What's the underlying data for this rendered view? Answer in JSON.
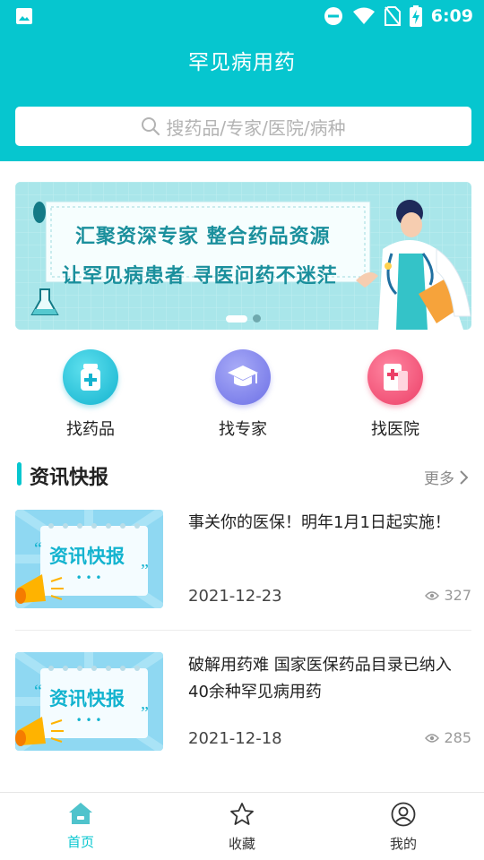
{
  "status_bar": {
    "time": "6:09",
    "icons": [
      "image-icon",
      "dnd-icon",
      "wifi-icon",
      "no-sim-icon",
      "battery-charging-icon"
    ]
  },
  "header": {
    "title": "罕见病用药"
  },
  "search": {
    "placeholder": "搜药品/专家/医院/病种",
    "icon": "search-icon"
  },
  "banner": {
    "line1": "汇聚资深专家 整合药品资源",
    "line2": "让罕见病患者 寻医问药不迷茫",
    "slides": 2,
    "active_slide": 1
  },
  "quick_actions": [
    {
      "label": "找药品",
      "icon": "medicine-bottle-icon",
      "color": "#2ec5dc"
    },
    {
      "label": "找专家",
      "icon": "graduation-cap-icon",
      "color": "#8a8ef0"
    },
    {
      "label": "找医院",
      "icon": "hospital-icon",
      "color": "#f2557a"
    }
  ],
  "news_section": {
    "title": "资讯快报",
    "more_label": "更多",
    "items": [
      {
        "thumb_text": "资讯快报",
        "title": "事关你的医保！明年1月1日起实施！",
        "date": "2021-12-23",
        "views": "327"
      },
      {
        "thumb_text": "资讯快报",
        "title": "破解用药难 国家医保药品目录已纳入40余种罕见病用药",
        "date": "2021-12-18",
        "views": "285"
      }
    ]
  },
  "tab_bar": {
    "tabs": [
      {
        "label": "首页",
        "icon": "home-icon",
        "active": true
      },
      {
        "label": "收藏",
        "icon": "star-icon",
        "active": false
      },
      {
        "label": "我的",
        "icon": "profile-icon",
        "active": false
      }
    ]
  },
  "colors": {
    "brand": "#06c6cf",
    "tab_active": "#06c6cf",
    "tab_inactive": "#333333"
  }
}
